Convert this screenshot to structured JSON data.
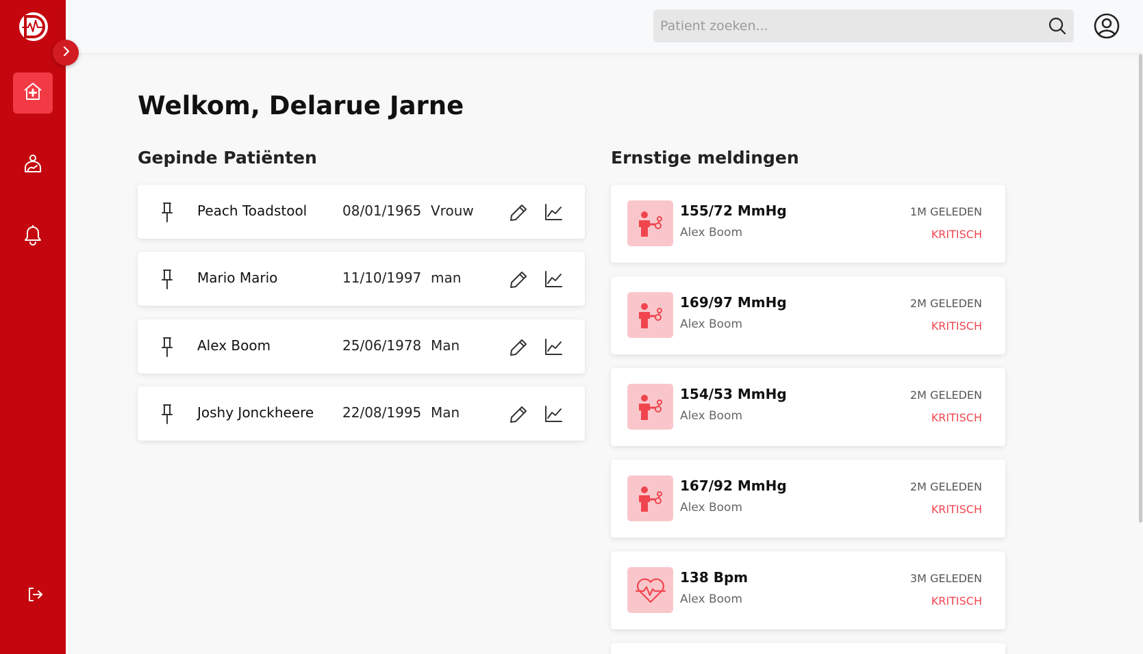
{
  "colors": {
    "sidebar_bg": "#c4070e",
    "active_nav": "#f23a45",
    "alert_icon_bg": "#f9c7cb",
    "alert_icon_fg": "#f0454f",
    "status_red": "#f0454f"
  },
  "sidebar": {
    "logo_icon": "heartbeat-logo-icon",
    "toggle_icon": "chevron-right-icon",
    "items": [
      {
        "icon": "hospital-home-icon",
        "active": true
      },
      {
        "icon": "patient-icon",
        "active": false
      },
      {
        "icon": "bell-icon",
        "active": false
      }
    ],
    "logout_icon": "logout-icon"
  },
  "header": {
    "search": {
      "placeholder": "Patient zoeken...",
      "value": "",
      "icon": "search-icon"
    },
    "profile_icon": "user-circle-icon"
  },
  "main": {
    "welcome": "Welkom, Delarue Jarne",
    "pinned": {
      "title": "Gepinde Patiënten",
      "patients": [
        {
          "name": "Peach Toadstool",
          "dob": "08/01/1965",
          "gender": "Vrouw"
        },
        {
          "name": "Mario Mario",
          "dob": "11/10/1997",
          "gender": "man"
        },
        {
          "name": "Alex Boom",
          "dob": "25/06/1978",
          "gender": "Man"
        },
        {
          "name": "Joshy Jonckheere",
          "dob": "22/08/1995",
          "gender": "Man"
        }
      ]
    },
    "alerts": {
      "title": "Ernstige meldingen",
      "items": [
        {
          "value": "155/72 MmHg",
          "patient": "Alex Boom",
          "time": "1M GELEDEN",
          "status": "KRITISCH",
          "icon": "blood-pressure-icon"
        },
        {
          "value": "169/97 MmHg",
          "patient": "Alex Boom",
          "time": "2M GELEDEN",
          "status": "KRITISCH",
          "icon": "blood-pressure-icon"
        },
        {
          "value": "154/53 MmHg",
          "patient": "Alex Boom",
          "time": "2M GELEDEN",
          "status": "KRITISCH",
          "icon": "blood-pressure-icon"
        },
        {
          "value": "167/92 MmHg",
          "patient": "Alex Boom",
          "time": "2M GELEDEN",
          "status": "KRITISCH",
          "icon": "blood-pressure-icon"
        },
        {
          "value": "138 Bpm",
          "patient": "Alex Boom",
          "time": "3M GELEDEN",
          "status": "KRITISCH",
          "icon": "heart-rate-icon"
        }
      ]
    }
  }
}
